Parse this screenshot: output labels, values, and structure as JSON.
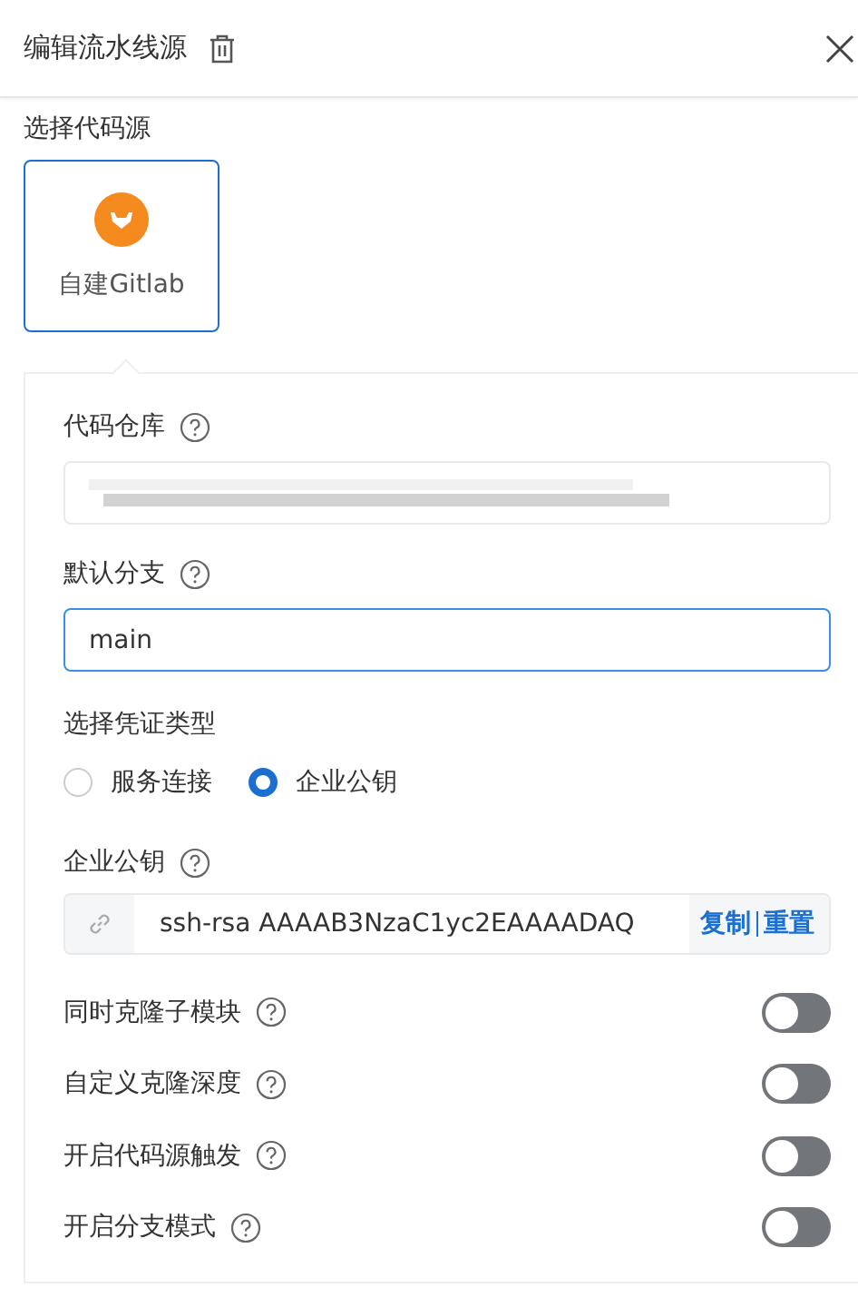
{
  "header": {
    "title": "编辑流水线源"
  },
  "source": {
    "label": "选择代码源",
    "options": [
      {
        "label": "自建Gitlab",
        "selected": true
      }
    ]
  },
  "repo": {
    "label": "代码仓库"
  },
  "branch": {
    "label": "默认分支",
    "value": "main"
  },
  "credential": {
    "label": "选择凭证类型",
    "options": [
      {
        "label": "服务连接",
        "selected": false
      },
      {
        "label": "企业公钥",
        "selected": true
      }
    ]
  },
  "public_key": {
    "label": "企业公钥",
    "value": "ssh-rsa AAAAB3NzaC1yc2EAAAADAQ",
    "actions": [
      "复制",
      "重置"
    ]
  },
  "switches": [
    {
      "label": "同时克隆子模块",
      "on": false
    },
    {
      "label": "自定义克隆深度",
      "on": false
    },
    {
      "label": "开启代码源触发",
      "on": false
    },
    {
      "label": "开启分支模式",
      "on": false
    }
  ]
}
